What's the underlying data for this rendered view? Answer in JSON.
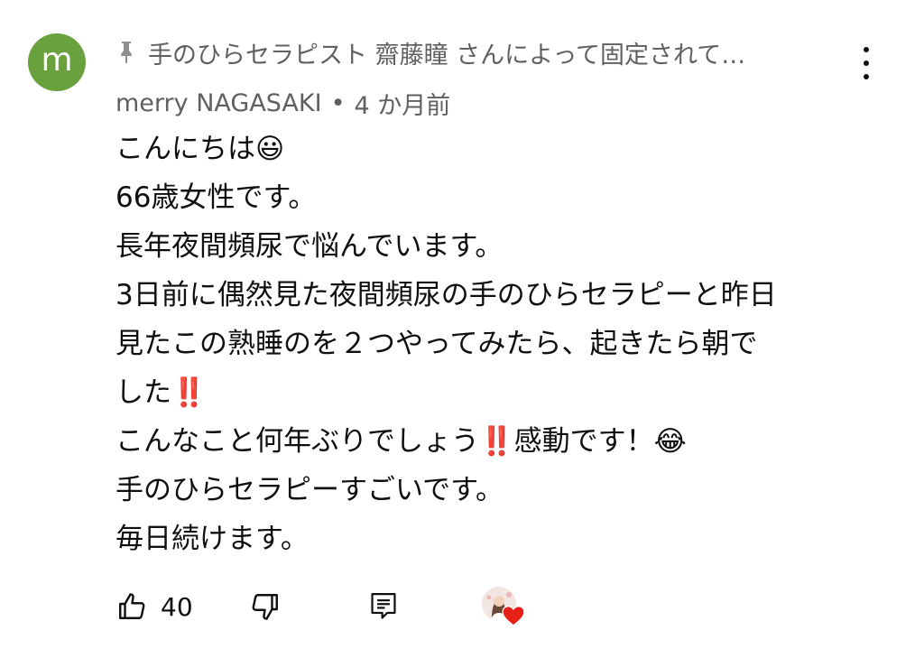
{
  "avatar": {
    "letter": "m",
    "color": "#6aa13f"
  },
  "pinned": {
    "icon": "pin-icon",
    "text": "手のひらセラピスト 齋藤瞳 さんによって固定されて…"
  },
  "comment": {
    "author": "merry NAGASAKI",
    "separator": "•",
    "time": "4 か月前",
    "lines": [
      "こんにちは😃",
      "66歳女性です。",
      "長年夜間頻尿で悩んでいます。",
      "3日前に偶然見た夜間頻尿の手のひらセラピーと昨日",
      "見たこの熟睡のを２つやってみたら、起きたら朝で",
      "した‼️",
      "こんなこと何年ぶりでしょう‼️感動です！😂",
      "手のひらセラピーすごいです。",
      "毎日続けます。"
    ]
  },
  "actions": {
    "like_icon": "thumbs-up-icon",
    "like_count": "40",
    "dislike_icon": "thumbs-down-icon",
    "reply_icon": "reply-icon",
    "creator_heart_icon": "creator-heart-icon",
    "heart_color": "#e62117"
  },
  "more_icon": "more-vert-icon"
}
